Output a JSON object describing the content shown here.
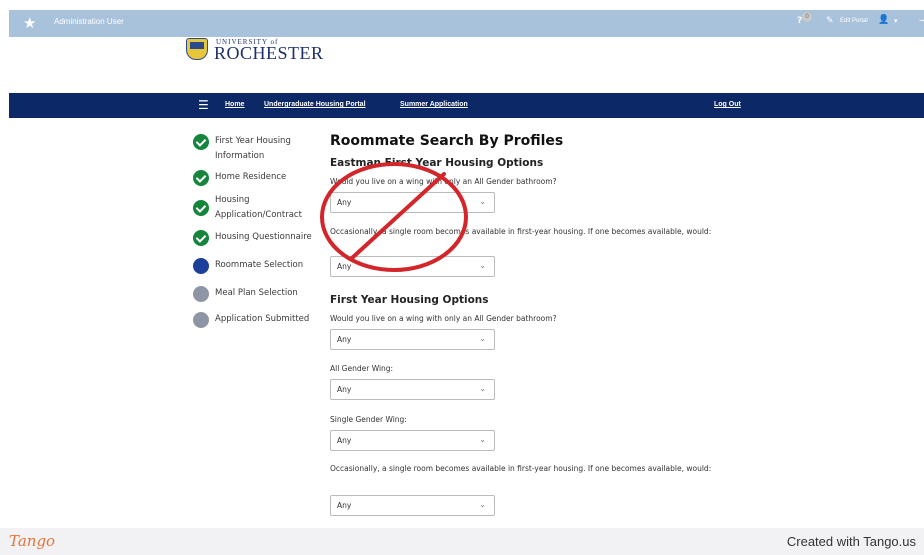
{
  "admin_bar": {
    "user": "Administration User",
    "help": "?",
    "notifications": "0",
    "edit_portal": "Edit Portal"
  },
  "logo": {
    "university": "UNIVERSITY of",
    "name": "ROCHESTER"
  },
  "nav": {
    "home": "Home",
    "portal": "Undergraduate Housing Portal",
    "summer": "Summer Application",
    "logout": "Log Out"
  },
  "steps": [
    {
      "label": "First Year Housing Information",
      "status": "complete"
    },
    {
      "label": "Home Residence",
      "status": "complete"
    },
    {
      "label": "Housing Application/Contract",
      "status": "complete"
    },
    {
      "label": "Housing Questionnaire",
      "status": "complete"
    },
    {
      "label": "Roommate Selection",
      "status": "current"
    },
    {
      "label": "Meal Plan Selection",
      "status": "pending"
    },
    {
      "label": "Application Submitted",
      "status": "pending"
    }
  ],
  "main": {
    "title": "Roommate Search By Profiles",
    "eastman": {
      "heading": "Eastman First Year Housing Options",
      "q1": "Would you live on a wing with only an All Gender bathroom?",
      "q1_value": "Any",
      "q2": "Occasionally, a single room becomes available in first-year housing. If one becomes available, would:",
      "q2_value": "Any"
    },
    "first_year": {
      "heading": "First Year Housing Options",
      "q1": "Would you live on a wing with only an All Gender bathroom?",
      "q1_value": "Any",
      "q2": "All Gender Wing:",
      "q2_value": "Any",
      "q3": "Single Gender Wing:",
      "q3_value": "Any",
      "q4": "Occasionally, a single room becomes available in first-year housing. If one becomes available, would:",
      "q4_value": "Any"
    }
  },
  "footer": {
    "brand": "Tango",
    "created": "Created with Tango.us"
  },
  "colors": {
    "admin_bar": "#a9c2dc",
    "navbar": "#0c2867",
    "step_complete": "#14853b",
    "step_current": "#1c3f9a",
    "step_pending": "#8e96a6",
    "annotation": "#d3262b"
  }
}
